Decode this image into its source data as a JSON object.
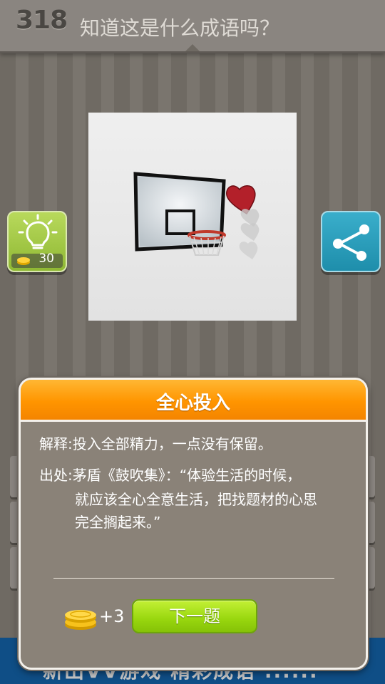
{
  "header": {
    "level": "318",
    "question": "知道这是什么成语吗？"
  },
  "hint": {
    "icon": "lightbulb-icon",
    "cost": "30",
    "coin_icon": "coin-stack-icon"
  },
  "share": {
    "icon": "share-icon"
  },
  "modal": {
    "idiom": "全心投入",
    "explain_label": "解释:",
    "explain_text": "投入全部精力，一点没有保留。",
    "source_label": "出处:",
    "source_line1": "茅盾《鼓吹集》：“体验生活的时候，",
    "source_line2": "就应该全心全意生活，把找题材的心思",
    "source_line3": "完全搁起来。”",
    "reward": "+3",
    "next_label": "下一题"
  },
  "banner": {
    "text": "新出VV游戏 精彩成语 ......"
  },
  "colors": {
    "modal_header": "#ff9a00",
    "next_button": "#9ad611",
    "hint_button": "#a6cb47",
    "share_button": "#2ba0bf",
    "banner": "#0f4e86"
  }
}
